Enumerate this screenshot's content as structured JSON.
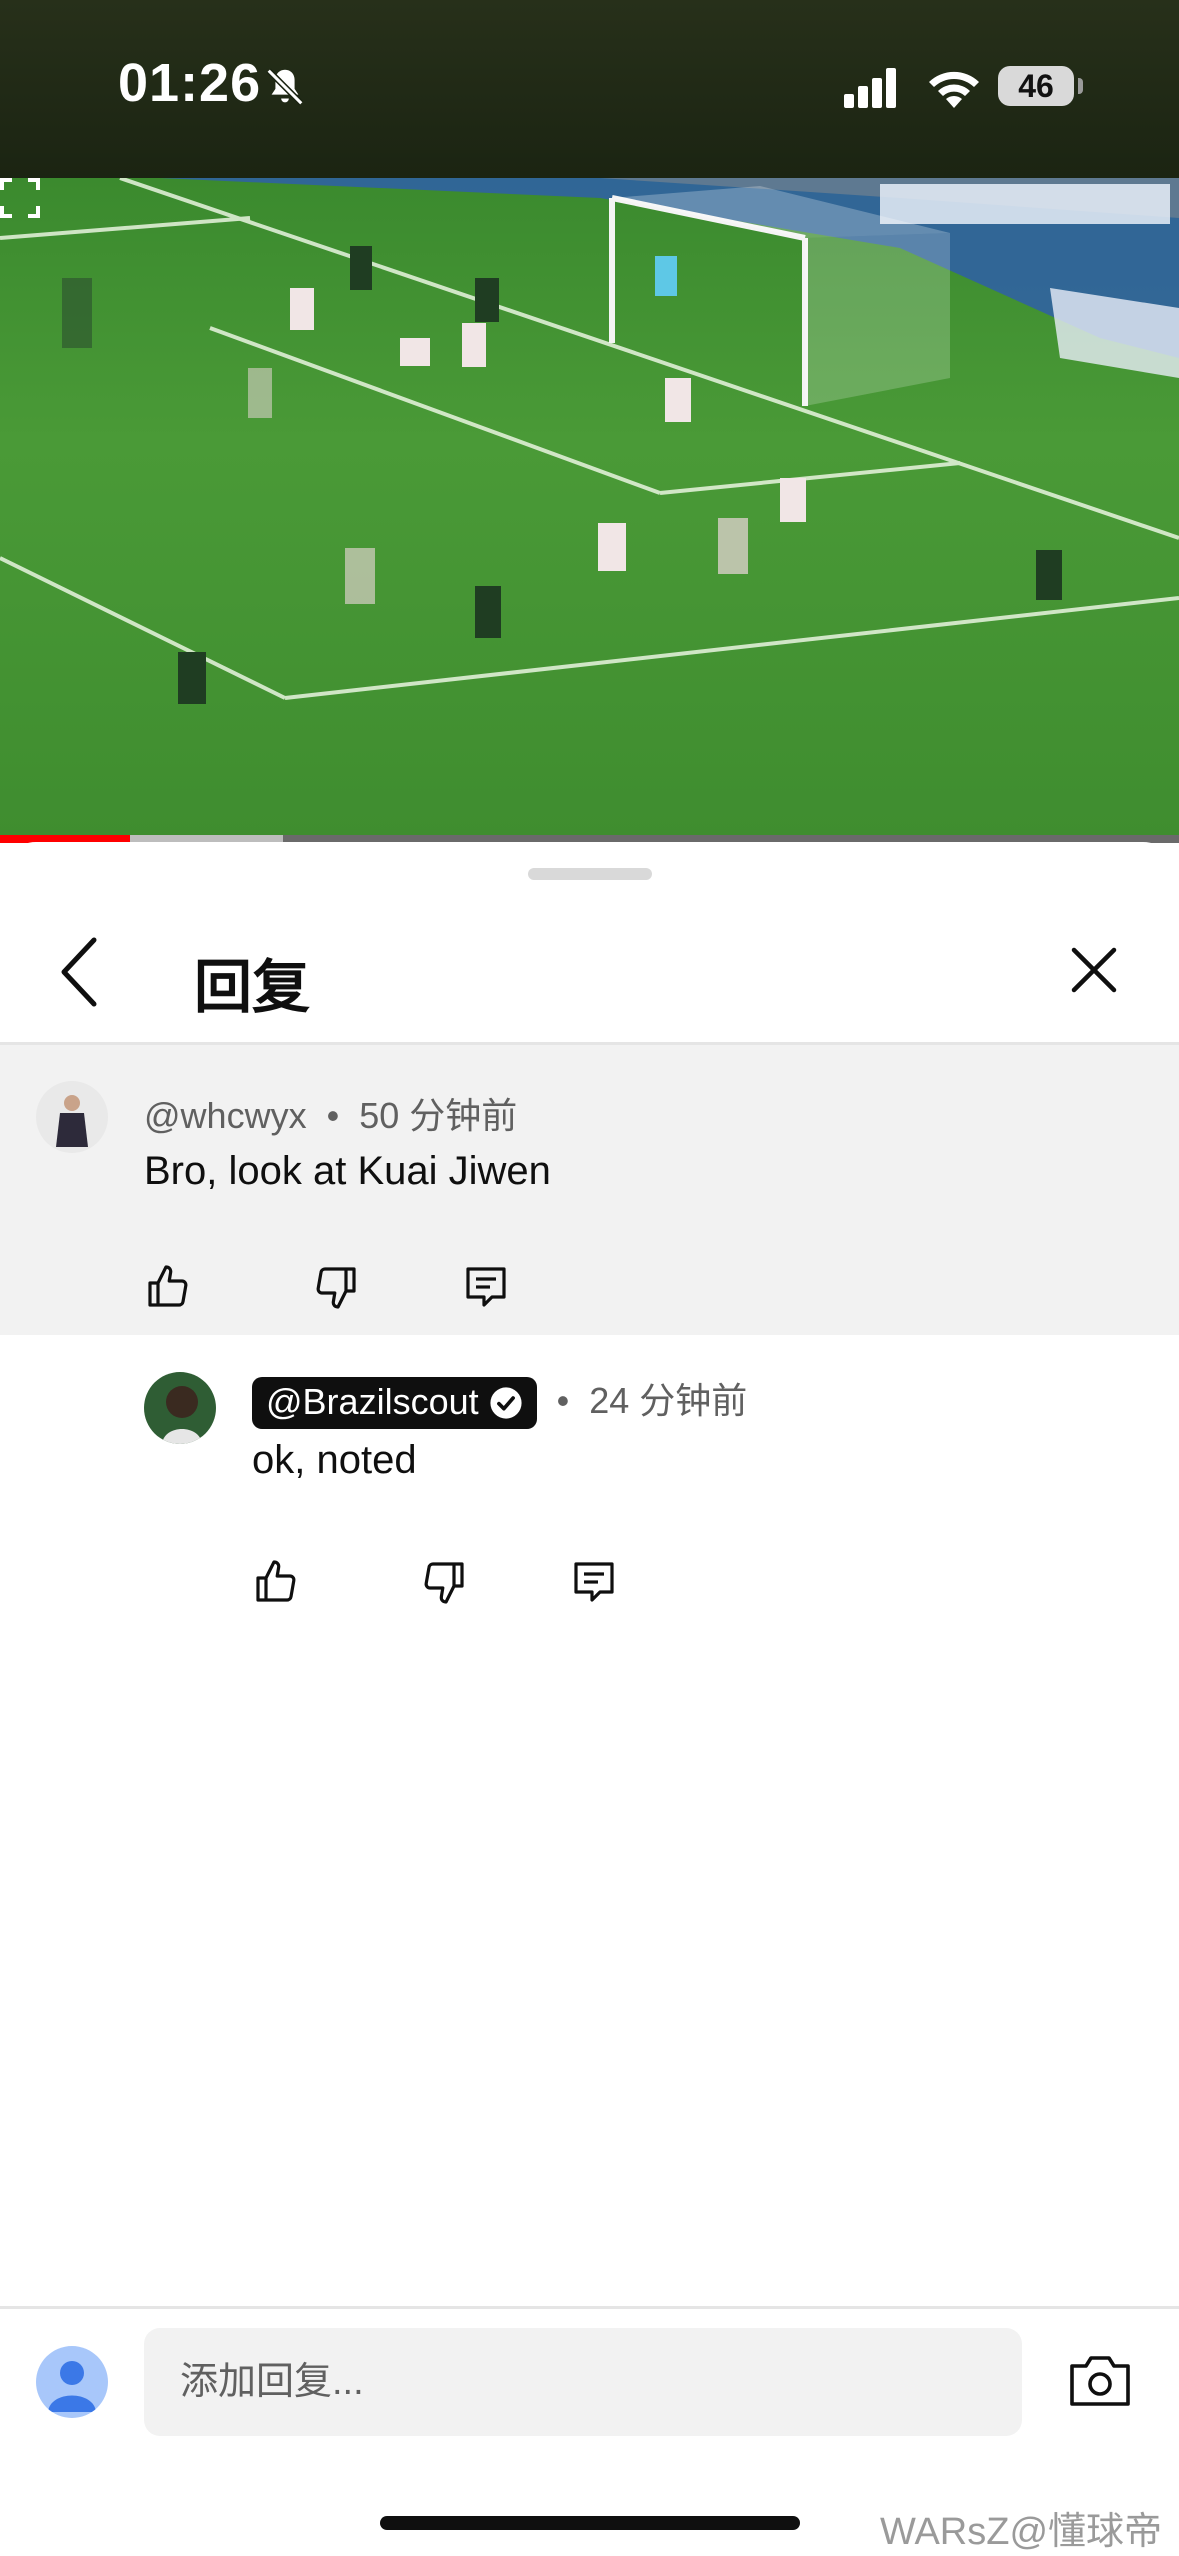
{
  "status_bar": {
    "time": "01:26",
    "battery": "46"
  },
  "video": {
    "progress_played": 0.11,
    "progress_buffered": 0.24
  },
  "sheet": {
    "title": "回复"
  },
  "parent_comment": {
    "author": "@whcwyx",
    "separator": "•",
    "time": "50 分钟前",
    "text": "Bro, look at Kuai Jiwen"
  },
  "reply": {
    "author": "@Brazilscout",
    "separator": "•",
    "time": "24 分钟前",
    "text": "ok, noted"
  },
  "composer": {
    "placeholder": "添加回复..."
  },
  "watermark": "WARsZ@懂球帝",
  "icons": {
    "back": "chevron-left-icon",
    "close": "close-icon",
    "like": "thumbs-up-icon",
    "dislike": "thumbs-down-icon",
    "reply": "comment-reply-icon",
    "camera": "camera-icon",
    "fullscreen": "fullscreen-icon",
    "verified": "verified-check-icon",
    "mute": "bell-slash-icon"
  },
  "colors": {
    "progress_played": "#ff0000",
    "highlight_bg": "#f2f2f2",
    "chip_bg": "#0f0f0f"
  }
}
